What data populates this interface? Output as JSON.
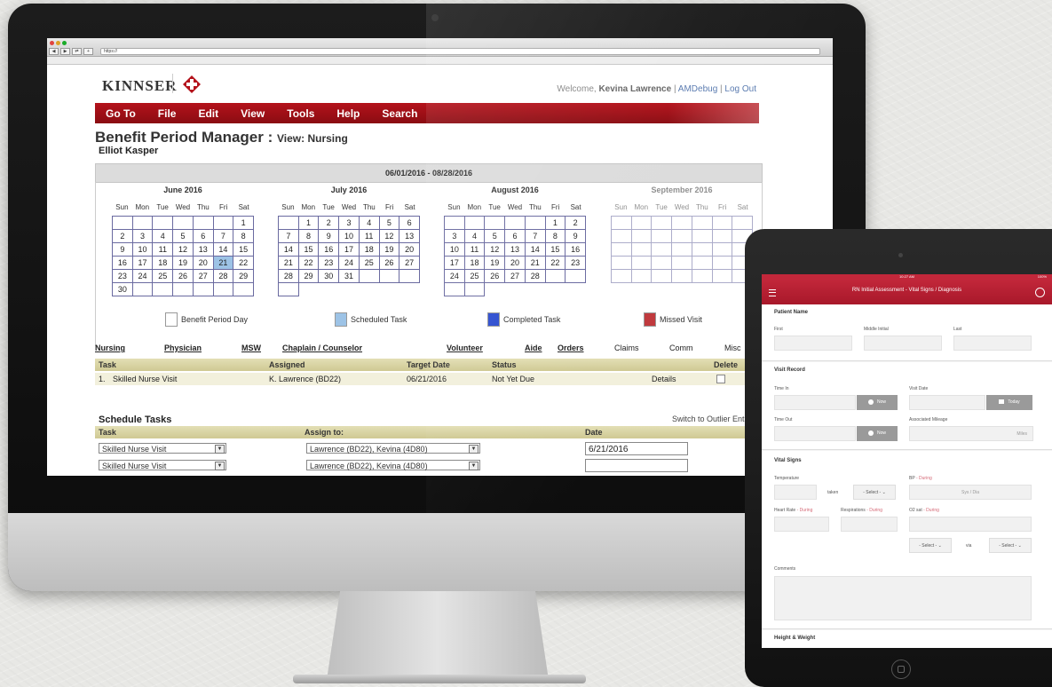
{
  "browser": {
    "url": "https://",
    "nav": [
      "◀",
      "▶",
      "⇄",
      "+"
    ]
  },
  "app": {
    "logo": "KINNSER",
    "welcome_prefix": "Welcome,",
    "user": "Kevina Lawrence",
    "am_debug": "AMDebug",
    "logout": "Log Out",
    "menu": [
      "Go To",
      "File",
      "Edit",
      "View",
      "Tools",
      "Help",
      "Search"
    ],
    "brand_color": "#b4121b"
  },
  "page": {
    "title": "Benefit Period Manager : ",
    "view": "View: Nursing",
    "patient": "Elliot Kasper",
    "period": "06/01/2016 - 08/28/2016"
  },
  "calendars": [
    {
      "title": "June 2016",
      "dow": [
        "Sun",
        "Mon",
        "Tue",
        "Wed",
        "Thu",
        "Fri",
        "Sat"
      ],
      "cells": [
        "",
        "",
        "",
        "",
        "",
        "",
        "1",
        "2",
        "3",
        "4",
        "5",
        "6",
        "7",
        "8",
        "9",
        "10",
        "11",
        "12",
        "13",
        "14",
        "15",
        "16",
        "17",
        "18",
        "19",
        "20",
        "21",
        "22",
        "23",
        "24",
        "25",
        "26",
        "27",
        "28",
        "29",
        "30",
        "",
        "",
        "",
        "",
        "",
        ""
      ],
      "today": "21"
    },
    {
      "title": "July 2016",
      "dow": [
        "Sun",
        "Mon",
        "Tue",
        "Wed",
        "Thu",
        "Fri",
        "Sat"
      ],
      "cells": [
        "",
        "1",
        "2",
        "3",
        "4",
        "5",
        "6",
        "7",
        "8",
        "9",
        "10",
        "11",
        "12",
        "13",
        "14",
        "15",
        "16",
        "17",
        "18",
        "19",
        "20",
        "21",
        "22",
        "23",
        "24",
        "25",
        "26",
        "27",
        "28",
        "29",
        "30",
        "31",
        "",
        "",
        "",
        ""
      ],
      "today": ""
    },
    {
      "title": "August 2016",
      "dow": [
        "Sun",
        "Mon",
        "Tue",
        "Wed",
        "Thu",
        "Fri",
        "Sat"
      ],
      "cells": [
        "",
        "",
        "",
        "",
        "",
        "1",
        "2",
        "3",
        "4",
        "5",
        "6",
        "7",
        "8",
        "9",
        "10",
        "11",
        "12",
        "13",
        "14",
        "15",
        "16",
        "17",
        "18",
        "19",
        "20",
        "21",
        "22",
        "23",
        "24",
        "25",
        "26",
        "27",
        "28",
        "",
        "",
        "",
        ""
      ],
      "today": ""
    },
    {
      "title": "September 2016",
      "dow": [
        "Sun",
        "Mon",
        "Tue",
        "Wed",
        "Thu",
        "Fri",
        "Sat"
      ],
      "cells": [
        "",
        "",
        "",
        "",
        "",
        "",
        "",
        "",
        "",
        "",
        "",
        "",
        "",
        "",
        "",
        "",
        "",
        "",
        "",
        "",
        "",
        "",
        "",
        "",
        "",
        "",
        "",
        "",
        "",
        "",
        "",
        "",
        "",
        "",
        ""
      ],
      "today": ""
    }
  ],
  "legend": [
    {
      "label": "Benefit Period Day",
      "color": "#ffffff"
    },
    {
      "label": "Scheduled Task",
      "color": "#9dc3e6"
    },
    {
      "label": "Completed Task",
      "color": "#2f4fd0"
    },
    {
      "label": "Missed Visit",
      "color": "#c0393d"
    }
  ],
  "tabs": [
    "Nursing",
    "Physician",
    "MSW",
    "Chaplain / Counselor",
    "Volunteer",
    "Aide",
    "Orders",
    "Claims",
    "Comm",
    "Misc"
  ],
  "task_table": {
    "headers": [
      "Task",
      "Assigned",
      "Target Date",
      "Status",
      "Delete"
    ],
    "rows": [
      {
        "num": "1.",
        "task": "Skilled Nurse Visit",
        "assigned": "K. Lawrence (BD22)",
        "date": "06/21/2016",
        "status": "Not Yet Due",
        "details": "Details"
      }
    ]
  },
  "schedule": {
    "title": "Schedule Tasks",
    "switch": "Switch to Outlier Entry",
    "headers": [
      "Task",
      "Assign to:",
      "Date"
    ],
    "rows": [
      {
        "task": "Skilled Nurse Visit",
        "assign": "Lawrence (BD22), Kevina (4D80)",
        "date": "6/21/2016"
      },
      {
        "task": "Skilled Nurse Visit",
        "assign": "Lawrence (BD22), Kevina (4D80)",
        "date": ""
      }
    ]
  },
  "ipad": {
    "status_time": "10:27 AM",
    "status_battery": "100%",
    "title": "RN Initial Assessment - Vital Signs / Diagnosis",
    "patient_name": "Patient Name",
    "first": "First",
    "middle": "Middle Initial",
    "last": "Last",
    "visit_record": "Visit Record",
    "time_in": "Time In",
    "visit_date": "Visit Date",
    "now": "Now",
    "today": "Today",
    "time_out": "Time Out",
    "mileage": "Associated Mileage",
    "miles": "Miles",
    "vital_signs": "Vital Signs",
    "temperature": "Temperature",
    "taken": "taken",
    "select": "- Select -",
    "bp": "BP",
    "during": "- During",
    "sys_dia": "Sys / Dia",
    "heart_rate": "Heart Rate",
    "respirations": "Respirations",
    "o2": "O2 sat",
    "via": "via",
    "comments": "Comments",
    "height_weight": "Height & Weight",
    "accent": "#c2273a"
  }
}
